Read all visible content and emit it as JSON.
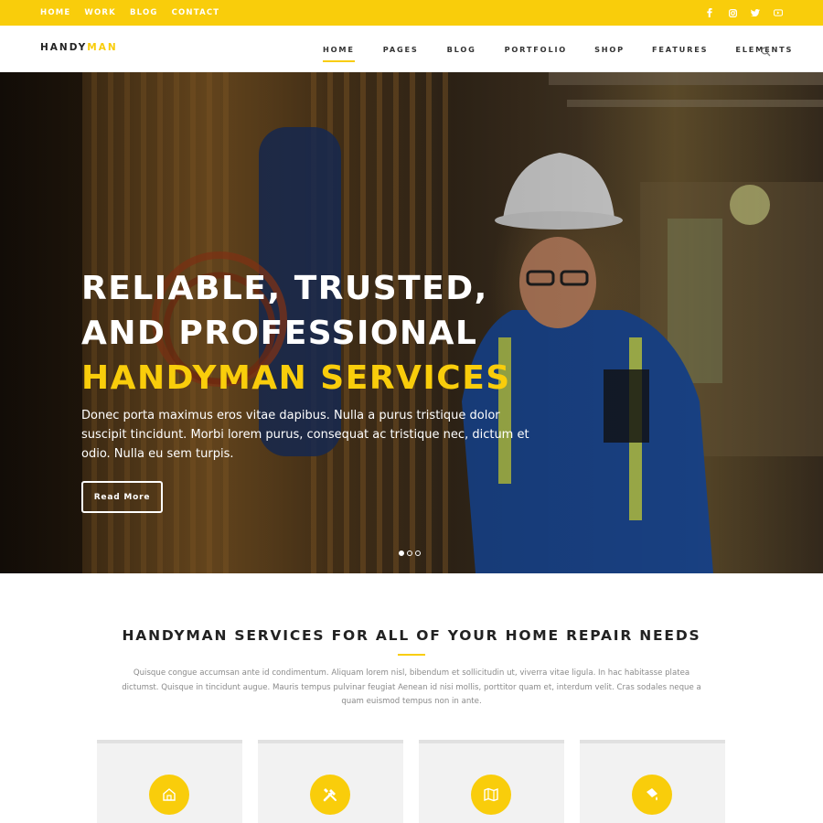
{
  "topbar": {
    "links": [
      "HOME",
      "WORK",
      "BLOG",
      "CONTACT"
    ],
    "social_icons": [
      "facebook-icon",
      "instagram-icon",
      "twitter-icon",
      "youtube-icon"
    ],
    "accent_color": "#f9cd0b"
  },
  "header": {
    "logo_main": "HANDY",
    "logo_accent": "MAN",
    "nav": [
      "HOME",
      "PAGES",
      "BLOG",
      "PORTFOLIO",
      "SHOP",
      "FEATURES",
      "ELEMENTS"
    ],
    "active_nav": "HOME",
    "search_icon": "search-icon"
  },
  "hero": {
    "title_line1": "RELIABLE, TRUSTED,",
    "title_line2": "AND PROFESSIONAL",
    "title_line3": "HANDYMAN SERVICES",
    "text": "Donec porta maximus eros vitae dapibus. Nulla a purus tristique dolor suscipit tincidunt. Morbi lorem purus, consequat ac tristique nec, dictum et odio. Nulla eu sem turpis.",
    "button_label": "Read More",
    "slides": 3,
    "active_slide": 1
  },
  "services": {
    "title": "HANDYMAN SERVICES FOR ALL OF YOUR HOME REPAIR NEEDS",
    "text": "Quisque congue accumsan ante id condimentum. Aliquam lorem nisl, bibendum et sollicitudin ut, viverra vitae ligula. In hac habitasse platea dictumst. Quisque in tincidunt augue. Mauris tempus pulvinar feugiat Aenean id nisi mollis, porttitor quam et, interdum velit. Cras sodales neque a quam euismod tempus non in ante.",
    "card_icons": [
      "home-icon",
      "tools-icon",
      "map-icon",
      "paint-roller-icon"
    ]
  }
}
